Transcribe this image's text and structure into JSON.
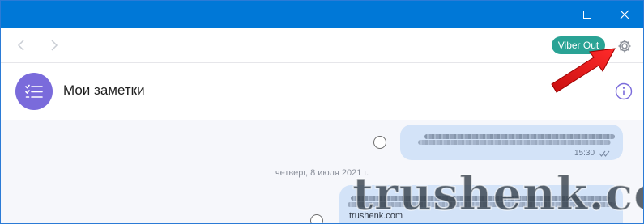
{
  "toolbar": {
    "viber_out_label": "Viber Out"
  },
  "chat": {
    "title": "Мои заметки"
  },
  "messages": [
    {
      "time": "15:30"
    }
  ],
  "date_separator": "четверг, 8 июля 2021 г.",
  "watermark": {
    "main": "trushenk.com",
    "small": "trushenk.com"
  },
  "colors": {
    "titlebar": "#0078d7",
    "viber_out": "#2aa395",
    "avatar": "#7a6bdb",
    "bubble": "#d3e3f8",
    "arrow": "#e81c1c"
  },
  "icons": [
    "minimize-icon",
    "maximize-icon",
    "close-icon",
    "back-arrow-icon",
    "forward-arrow-icon",
    "gear-icon",
    "notes-list-icon",
    "info-icon",
    "double-check-icon"
  ]
}
